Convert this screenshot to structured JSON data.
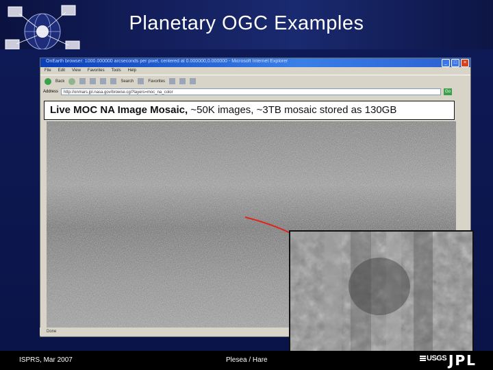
{
  "slide": {
    "title": "Planetary OGC Examples",
    "caption_bold": "Live MOC NA Image Mosaic,",
    "caption_rest": " ~50K images, ~3TB mosaic stored as 130GB",
    "footer_left": "ISPRS, Mar 2007",
    "footer_center": "Plesea / Hare",
    "logo_usgs": "USGS",
    "logo_jpl": "JPL"
  },
  "browser": {
    "window_title": "OnEarth browser: 1000.000000 arcseconds per pixel, centered at 0.000000,0.000000 - Microsoft Internet Explorer",
    "menu": [
      "File",
      "Edit",
      "View",
      "Favorites",
      "Tools",
      "Help"
    ],
    "toolbar": {
      "back": "Back",
      "search": "Search",
      "favorites": "Favorites"
    },
    "address_label": "Address",
    "address_value": "http://onmars.jpl.nasa.gov/browse.cgi?layers=moc_na_color",
    "go_label": "Go",
    "status": "Done"
  },
  "colors": {
    "banner": "#14205e",
    "body": "#0e1a55",
    "titlebar": "#2a5fd0",
    "route": "#e0241c"
  }
}
